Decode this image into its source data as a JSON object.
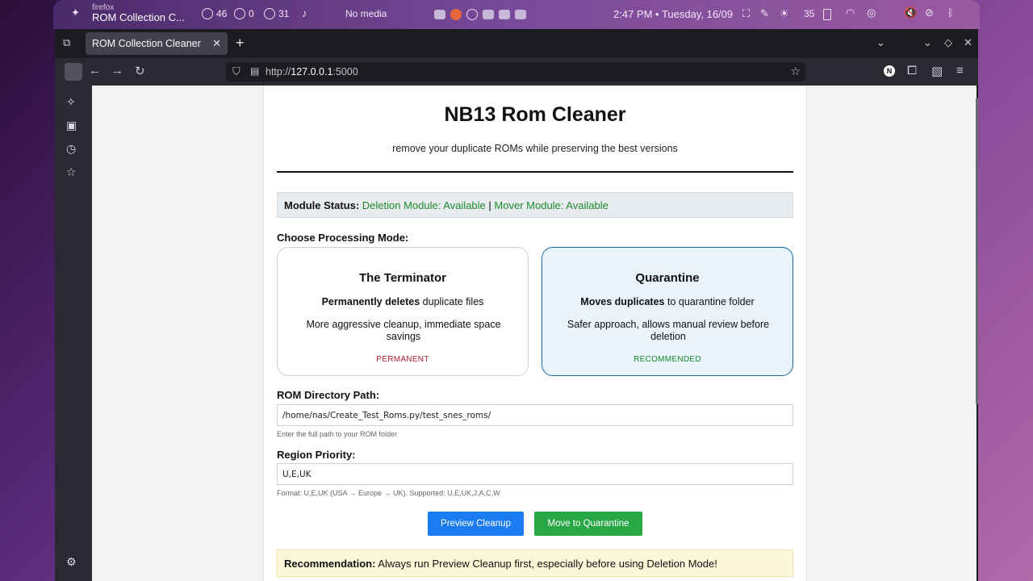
{
  "topbar": {
    "app_small": "firefox",
    "app_title": "ROM Collection C...",
    "count_a": "46",
    "count_b": "0",
    "count_c": "31",
    "media": "No media",
    "clock": "2:47 PM • Tuesday, 16/09",
    "brightness": "35"
  },
  "browser": {
    "tab_title": "ROM Collection Cleaner",
    "url_prefix": "http://",
    "url_host": "127.0.0.1",
    "url_port": ":5000"
  },
  "page": {
    "title": "NB13 Rom Cleaner",
    "subtitle": "remove your duplicate ROMs while preserving the best versions",
    "status": {
      "label": "Module Status:",
      "deletion": "Deletion Module: Available",
      "separator": "|",
      "mover": "Mover Module: Available"
    },
    "mode_label": "Choose Processing Mode:",
    "modes": [
      {
        "title": "The Terminator",
        "bold": "Permanently deletes",
        "rest": " duplicate files",
        "desc": "More aggressive cleanup, immediate space savings",
        "tag": "PERMANENT"
      },
      {
        "title": "Quarantine",
        "bold": "Moves duplicates",
        "rest": " to quarantine folder",
        "desc": "Safer approach, allows manual review before deletion",
        "tag": "RECOMMENDED"
      }
    ],
    "rom_dir": {
      "label": "ROM Directory Path:",
      "value": "/home/nas/Create_Test_Roms.py/test_snes_roms/",
      "hint": "Enter the full path to your ROM folder"
    },
    "region": {
      "label": "Region Priority:",
      "value": "U,E,UK",
      "hint": "Format: U,E,UK (USA → Europe → UK). Supported: U,E,UK,J,A,C,W"
    },
    "buttons": {
      "preview": "Preview Cleanup",
      "move": "Move to Quarantine"
    },
    "recommendation": {
      "label": "Recommendation:",
      "text": " Always run Preview Cleanup first, especially before using Deletion Mode!"
    }
  }
}
